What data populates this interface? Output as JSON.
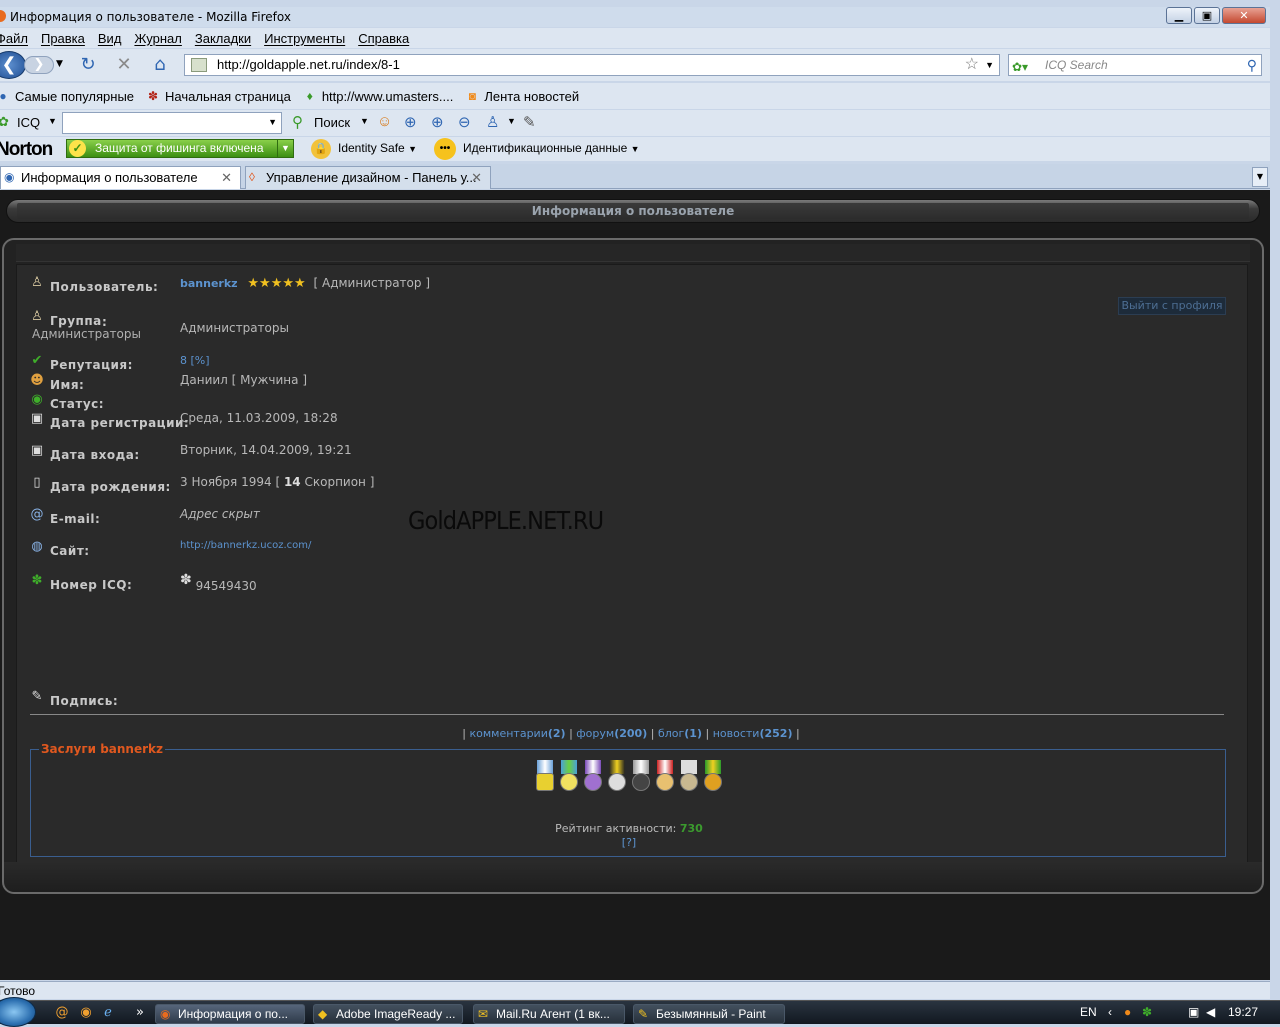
{
  "window": {
    "title": "Информация о пользователе - Mozilla Firefox",
    "min": "▁",
    "max": "▣",
    "close": "✕"
  },
  "menu": [
    "Файл",
    "Правка",
    "Вид",
    "Журнал",
    "Закладки",
    "Инструменты",
    "Справка"
  ],
  "nav": {
    "url": "http://goldapple.net.ru/index/8-1",
    "search_placeholder": "ICQ Search"
  },
  "bookmarks": [
    {
      "label": "Самые популярные",
      "icon": "blue-globe-icon"
    },
    {
      "label": "Начальная страница",
      "icon": "red-paw-icon"
    },
    {
      "label": "http://www.umasters....",
      "icon": "green-drop-icon"
    },
    {
      "label": "Лента новостей",
      "icon": "rss-icon"
    }
  ],
  "icqbar": {
    "icq_label": "ICQ",
    "search_label": "Поиск"
  },
  "norton": {
    "logo": "Norton",
    "phishing": "Защита от фишинга включена",
    "identity_safe": "Identity Safe",
    "identity_data": "Идентификационные данные"
  },
  "tabs": [
    {
      "label": "Информация о пользователе",
      "active": true
    },
    {
      "label": "Управление дизайном - Панель у...",
      "active": false
    }
  ],
  "page": {
    "header": "Информация о пользователе",
    "exit_profile": "Выйти с профиля",
    "watermark": "GoldAPPLE.NET.RU",
    "fields": {
      "user_label": "Пользователь:",
      "user_name": "bannerkz",
      "user_role": "[ Администратор ]",
      "group_label": "Группа",
      "group_sub": "Администраторы",
      "group_value": "Администраторы",
      "rep_label": "Репутация:",
      "rep_value": "8 [%]",
      "name_label": "Имя:",
      "name_value": "Даниил [ Мужчина ]",
      "status_label": "Статус:",
      "reg_label": "Дата регистрации:",
      "reg_value": "Среда, 11.03.2009, 18:28",
      "login_label": "Дата входа:",
      "login_value": "Вторник, 14.04.2009, 19:21",
      "birth_label": "Дата рождения:",
      "birth_value_a": "3 Ноября 1994 [",
      "birth_value_age": "14",
      "birth_value_b": "Скорпион ]",
      "email_label": "E-mail:",
      "email_value": "Адрес скрыт",
      "site_label": "Сайт:",
      "site_value": "http://bannerkz.ucoz.com/",
      "icq_label": "Номер ICQ:",
      "icq_value": "94549430",
      "sig_label": "Подпись:"
    },
    "links": {
      "comments": "комментарии",
      "comments_n": "(2)",
      "forum": "форум",
      "forum_n": "(200)",
      "blog": "блог",
      "blog_n": "(1)",
      "news": "новости",
      "news_n": "(252)"
    },
    "merits": {
      "title": "Заслуги bannerkz",
      "rating_label": "Рейтинг активности:",
      "rating_value": "730",
      "help": "[?]"
    }
  },
  "status": "Готово",
  "taskbar": {
    "items": [
      {
        "label": "Информация о по...",
        "active": true
      },
      {
        "label": "Adobe ImageReady ...",
        "active": false
      },
      {
        "label": "Mail.Ru Агент (1 вк...",
        "active": false
      },
      {
        "label": "Безымянный - Paint",
        "active": false
      }
    ],
    "lang": "EN",
    "clock": "19:27",
    "more": "»"
  },
  "colors": {
    "link": "#5c93cf",
    "merit_title": "#e0581f",
    "rating": "#3b9a2e"
  }
}
